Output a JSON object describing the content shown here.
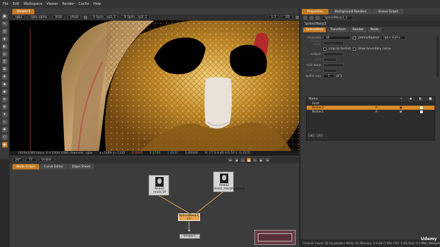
{
  "menubar": [
    "File",
    "Edit",
    "Workspace",
    "Viewer",
    "Render",
    "Cache",
    "Help"
  ],
  "viewer": {
    "tab": "Viewer1",
    "channels": "rgba",
    "layer": "rgba.alpha",
    "colorspace": "RGB",
    "zoom": "sRGB",
    "gain_label": "f/8",
    "gamma_label": "1",
    "a_input": "A Splin…sp1_1",
    "b_input": "B Splin…sp2_1",
    "proxy": "1:1",
    "mode": "2D",
    "info_left": "1920x1080  bbox: 0 0 1920 1080 channels: rgba",
    "info_xy": "x=1469 y=1332",
    "info_r": "0.0942",
    "info_g": "0.5700",
    "info_b": "1.0000",
    "info_a": "1.00000",
    "info_right": "H: 27 S:0.40 V:0.54  L: 0.3120"
  },
  "playback": {
    "fps": "24*",
    "range": "TF",
    "mode": "Visible"
  },
  "nodegraph": {
    "tabs": [
      "Node Graph",
      "Curve Editor",
      "Dope Sheet"
    ],
    "read1": "Read1",
    "read1_file": "mask.tif",
    "read2": "Read2",
    "read2_file": "mask_morphed.png",
    "spline": "SplineWarp3_1",
    "spline_sub": "(1)",
    "viewer": "Viewer1"
  },
  "properties": {
    "tabs": [
      "Properties",
      "Background Renders",
      "Scene Graph"
    ],
    "node_name": "SplineWarp3_1",
    "node_header": "SplineWarp3",
    "sub_tabs": [
      "SplineWarp",
      "Transform",
      "Render",
      "Node"
    ],
    "channels_label": "channels",
    "channels_val": "all",
    "premult_label": "premultiplied",
    "premult_val": "rgba.alpha",
    "isolate_label": "isolate mask",
    "crop_label": "crop to format",
    "blow_label": "blow boundary curve",
    "output_label": "output",
    "mix_label": "mix",
    "root_warp_label": "root warp",
    "lock_warp_label": "lock warp",
    "splinekey_label": "spline key",
    "splinekey_of": "of 1",
    "table_header": "Name",
    "rows": [
      {
        "name": "Root",
        "c1": "",
        "c2": "",
        "c3": ""
      },
      {
        "name": "Bezier2",
        "c1": "A",
        "c2": "",
        "c3": ""
      },
      {
        "name": "Bezier1",
        "c1": "A",
        "c2": "",
        "c3": ""
      }
    ]
  },
  "statusbar": "Channel Count: 32  Localization Mode: On  Memory: 3.9 GB (7.0%)  CPU: 1.6%  Disk: 0.0 MB/s  Network: 0.0 MB/s",
  "watermark": "Udemy"
}
